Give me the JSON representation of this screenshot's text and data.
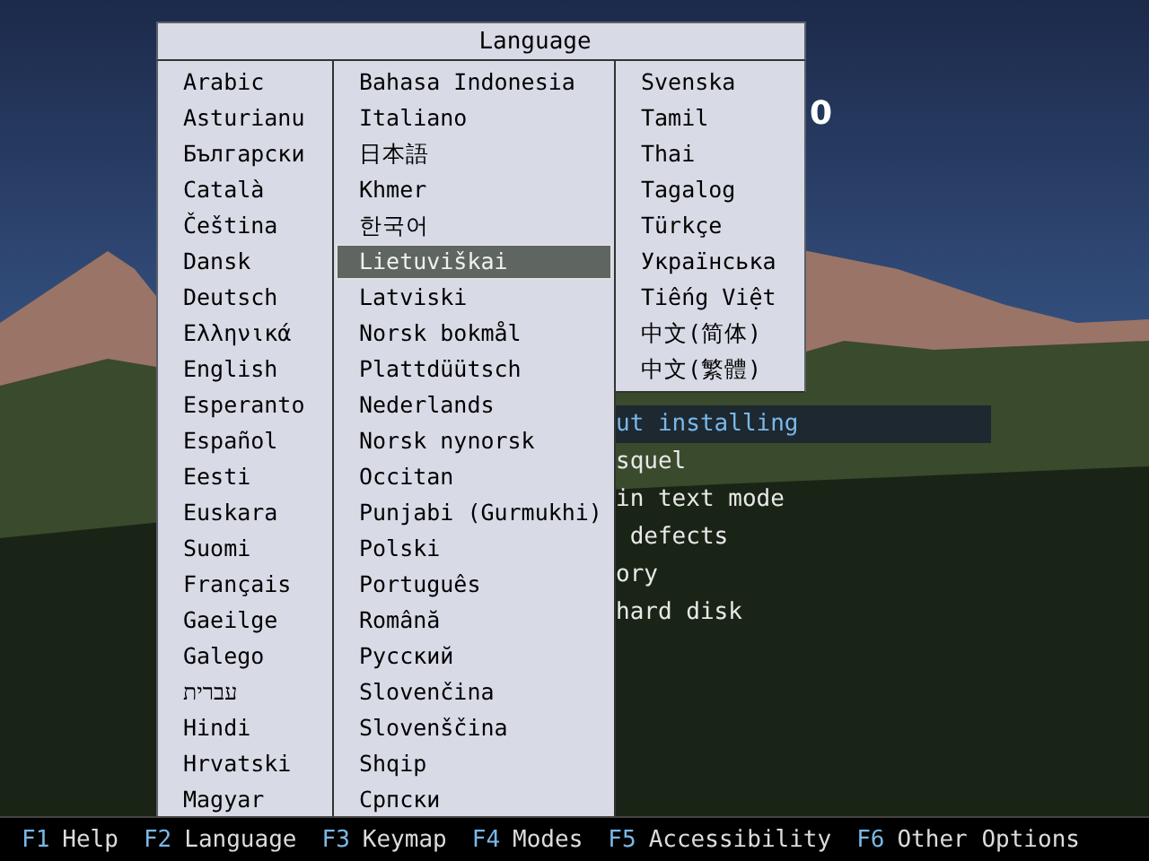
{
  "logo_fragment": "0",
  "boot_menu": {
    "items": [
      {
        "label": "ut installing",
        "selected": true
      },
      {
        "label": "squel",
        "selected": false
      },
      {
        "label": "in text mode",
        "selected": false
      },
      {
        "label": " defects",
        "selected": false
      },
      {
        "label": "ory",
        "selected": false
      },
      {
        "label": "hard disk",
        "selected": false
      }
    ]
  },
  "dialog": {
    "title": "Language",
    "columns": [
      [
        {
          "label": "Arabic",
          "selected": false
        },
        {
          "label": "Asturianu",
          "selected": false
        },
        {
          "label": "Български",
          "selected": false
        },
        {
          "label": "Català",
          "selected": false
        },
        {
          "label": "Čeština",
          "selected": false
        },
        {
          "label": "Dansk",
          "selected": false
        },
        {
          "label": "Deutsch",
          "selected": false
        },
        {
          "label": "Ελληνικά",
          "selected": false
        },
        {
          "label": "English",
          "selected": false
        },
        {
          "label": "Esperanto",
          "selected": false
        },
        {
          "label": "Español",
          "selected": false
        },
        {
          "label": "Eesti",
          "selected": false
        },
        {
          "label": "Euskara",
          "selected": false
        },
        {
          "label": "Suomi",
          "selected": false
        },
        {
          "label": "Français",
          "selected": false
        },
        {
          "label": "Gaeilge",
          "selected": false
        },
        {
          "label": "Galego",
          "selected": false
        },
        {
          "label": "עברית",
          "selected": false
        },
        {
          "label": "Hindi",
          "selected": false
        },
        {
          "label": "Hrvatski",
          "selected": false
        },
        {
          "label": "Magyar",
          "selected": false
        }
      ],
      [
        {
          "label": "Bahasa Indonesia",
          "selected": false
        },
        {
          "label": "Italiano",
          "selected": false
        },
        {
          "label": "日本語",
          "selected": false
        },
        {
          "label": "Khmer",
          "selected": false
        },
        {
          "label": "한국어",
          "selected": false
        },
        {
          "label": "Lietuviškai",
          "selected": true
        },
        {
          "label": "Latviski",
          "selected": false
        },
        {
          "label": "Norsk bokmål",
          "selected": false
        },
        {
          "label": "Plattdüütsch",
          "selected": false
        },
        {
          "label": "Nederlands",
          "selected": false
        },
        {
          "label": "Norsk nynorsk",
          "selected": false
        },
        {
          "label": "Occitan",
          "selected": false
        },
        {
          "label": "Punjabi (Gurmukhi)",
          "selected": false
        },
        {
          "label": "Polski",
          "selected": false
        },
        {
          "label": "Português",
          "selected": false
        },
        {
          "label": "Română",
          "selected": false
        },
        {
          "label": "Русский",
          "selected": false
        },
        {
          "label": "Slovenčina",
          "selected": false
        },
        {
          "label": "Slovenščina",
          "selected": false
        },
        {
          "label": "Shqip",
          "selected": false
        },
        {
          "label": "Српски",
          "selected": false
        }
      ],
      [
        {
          "label": "Svenska",
          "selected": false
        },
        {
          "label": "Tamil",
          "selected": false
        },
        {
          "label": "Thai",
          "selected": false
        },
        {
          "label": "Tagalog",
          "selected": false
        },
        {
          "label": "Türkçe",
          "selected": false
        },
        {
          "label": "Українська",
          "selected": false
        },
        {
          "label": "Tiếng Việt",
          "selected": false
        },
        {
          "label": "中文(简体)",
          "selected": false
        },
        {
          "label": "中文(繁體)",
          "selected": false
        }
      ]
    ]
  },
  "footer": [
    {
      "key": "F1",
      "label": "Help"
    },
    {
      "key": "F2",
      "label": "Language"
    },
    {
      "key": "F3",
      "label": "Keymap"
    },
    {
      "key": "F4",
      "label": "Modes"
    },
    {
      "key": "F5",
      "label": "Accessibility"
    },
    {
      "key": "F6",
      "label": "Other Options"
    }
  ]
}
